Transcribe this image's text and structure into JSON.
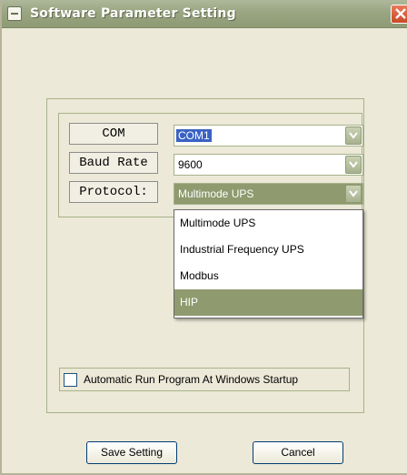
{
  "window": {
    "title": "Software Parameter Setting"
  },
  "fields": [
    {
      "label": "COM",
      "value": "COM1"
    },
    {
      "label": "Baud Rate",
      "value": "9600"
    },
    {
      "label": "Protocol:",
      "value": "Multimode UPS"
    }
  ],
  "protocol_dropdown": {
    "options": [
      "Multimode UPS",
      "Industrial Frequency UPS",
      "Modbus",
      "HIP"
    ],
    "highlighted": "HIP"
  },
  "startup": {
    "label": "Automatic Run Program At Windows Startup",
    "checked": false
  },
  "buttons": {
    "save": "Save Setting",
    "cancel": "Cancel"
  },
  "colors": {
    "titlebar": "#9aa582",
    "selection": "#3a62c3",
    "highlight": "#8f9a6e"
  },
  "icons": {
    "system": "window-menu-icon",
    "close": "close-icon",
    "dropdown": "chevron-down-icon"
  }
}
